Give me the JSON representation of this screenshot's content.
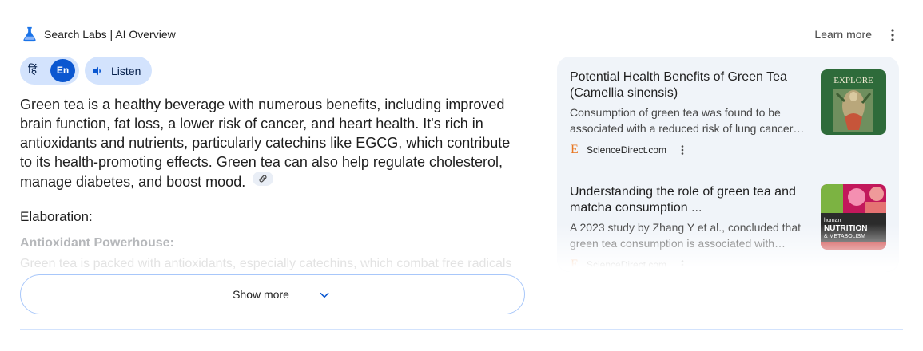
{
  "header": {
    "brand": "Search Labs | AI Overview",
    "learn_more": "Learn more"
  },
  "controls": {
    "lang_hi": "हिं",
    "lang_en": "En",
    "listen": "Listen"
  },
  "overview": {
    "summary": "Green tea is a healthy beverage with numerous benefits, including improved brain function, fat loss, a lower risk of cancer, and heart health. It's rich in antioxidants and nutrients, particularly catechins like EGCG, which contribute to its health-promoting effects. Green tea can also help regulate cholesterol, manage diabetes, and boost mood.",
    "elaboration_heading": "Elaboration:",
    "subheading": "Antioxidant Powerhouse:",
    "faded_line": "Green tea is packed with antioxidants, especially catechins, which combat free radicals"
  },
  "show_more": "Show more",
  "sources": [
    {
      "title": "Potential Health Benefits of Green Tea (Camellia sinensis)",
      "snippet": "Consumption of green tea was found to be associated with a reduced risk of lung cancer…",
      "site": "ScienceDirect.com",
      "favicon": "E",
      "thumb_text": "EXPLORE"
    },
    {
      "title": "Understanding the role of green tea and matcha consumption ...",
      "snippet": "A 2023 study by Zhang Y et al., concluded that green tea consumption is associated with…",
      "site": "ScienceDirect.com",
      "favicon": "E",
      "thumb_text_1": "human",
      "thumb_text_2": "NUTRITION",
      "thumb_text_3": "& METABOLISM"
    }
  ],
  "colors": {
    "accent": "#0b57d0",
    "chip_bg": "#d3e3fd",
    "panel_bg": "#f0f4f9",
    "border": "#a8c7fa"
  }
}
